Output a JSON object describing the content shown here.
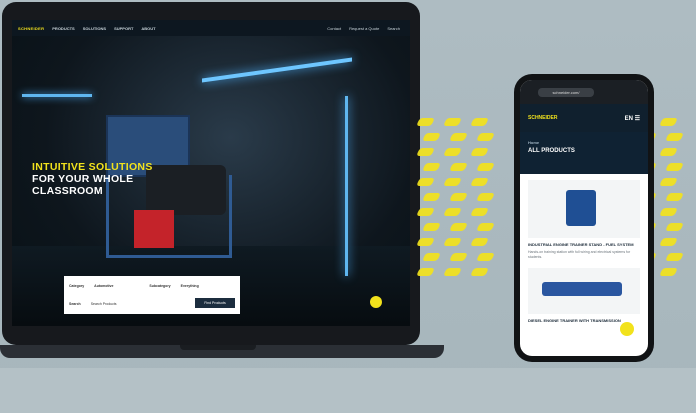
{
  "laptop": {
    "nav": {
      "logo": "SCHNEIDER",
      "items": [
        "PRODUCTS",
        "SOLUTIONS",
        "SUPPORT",
        "ABOUT"
      ],
      "right": [
        "Contact",
        "Request a Quote",
        "Search"
      ]
    },
    "hero": {
      "line1": "INTUITIVE SOLUTIONS",
      "line2": "FOR YOUR WHOLE",
      "line3": "CLASSROOM"
    },
    "search": {
      "label1": "Category",
      "value1": "Automotive",
      "label2": "Subcategory",
      "value2": "Everything",
      "label3": "Search",
      "placeholder": "Search Products",
      "button": "Find Products"
    }
  },
  "phone": {
    "url": "schneider.com/",
    "logo": "SCHNEIDER",
    "nav_icons": "EN  ☰",
    "crumb": "Home",
    "heading": "ALL PRODUCTS",
    "card1": {
      "title": "INDUSTRIAL ENGINE TRAINER STAND - FUEL SYSTEM",
      "text": "Hands-on training station with full wiring and electrical systems for students."
    },
    "card2": {
      "title": "DIESEL ENGINE TRAINER WITH TRANSMISSION"
    }
  },
  "colors": {
    "accent": "#f2e21c",
    "navy": "#10202e",
    "background": "#a8b7bd"
  }
}
